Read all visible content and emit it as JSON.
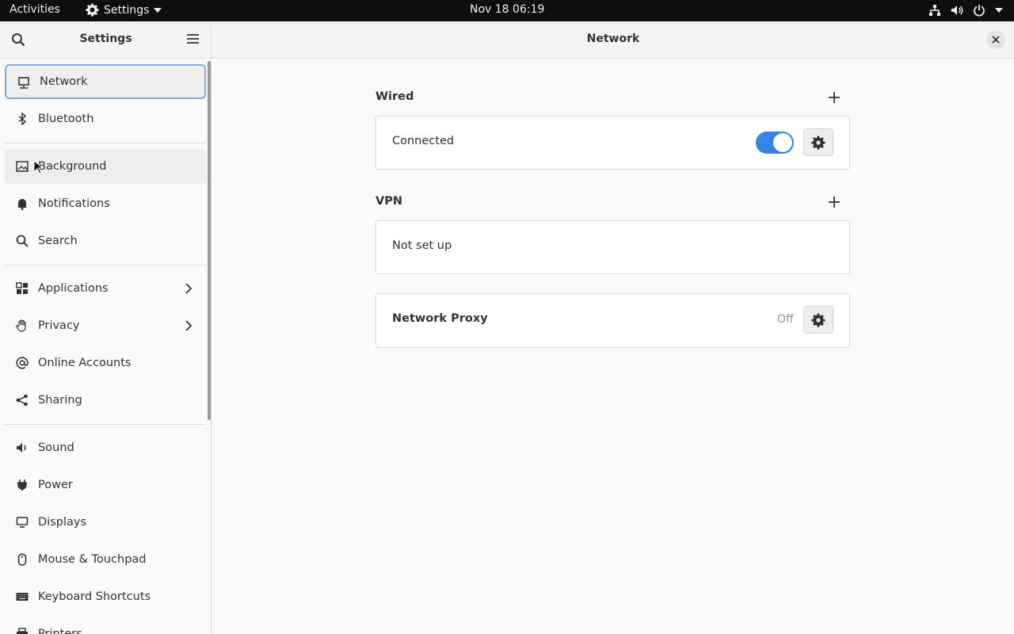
{
  "topbar": {
    "activities": "Activities",
    "app_menu": "Settings",
    "clock": "Nov 18  06:19"
  },
  "sidebar": {
    "title": "Settings",
    "items": [
      {
        "label": "Network",
        "icon": "network-icon"
      },
      {
        "label": "Bluetooth",
        "icon": "bluetooth-icon"
      },
      {
        "label": "Background",
        "icon": "background-icon"
      },
      {
        "label": "Notifications",
        "icon": "bell-icon"
      },
      {
        "label": "Search",
        "icon": "search-icon"
      },
      {
        "label": "Applications",
        "icon": "apps-grid-icon"
      },
      {
        "label": "Privacy",
        "icon": "hand-icon"
      },
      {
        "label": "Online Accounts",
        "icon": "at-icon"
      },
      {
        "label": "Sharing",
        "icon": "share-icon"
      },
      {
        "label": "Sound",
        "icon": "speaker-icon"
      },
      {
        "label": "Power",
        "icon": "power-plug-icon"
      },
      {
        "label": "Displays",
        "icon": "monitor-icon"
      },
      {
        "label": "Mouse & Touchpad",
        "icon": "mouse-icon"
      },
      {
        "label": "Keyboard Shortcuts",
        "icon": "keyboard-icon"
      },
      {
        "label": "Printers",
        "icon": "printer-icon"
      }
    ]
  },
  "main": {
    "title": "Network",
    "wired": {
      "heading": "Wired",
      "status": "Connected",
      "toggle_on": true
    },
    "vpn": {
      "heading": "VPN",
      "status": "Not set up"
    },
    "proxy": {
      "label": "Network Proxy",
      "state": "Off"
    }
  },
  "colors": {
    "accent": "#3584e4",
    "topbar": "#0f0f0f",
    "selection_border": "#86a9d8"
  }
}
